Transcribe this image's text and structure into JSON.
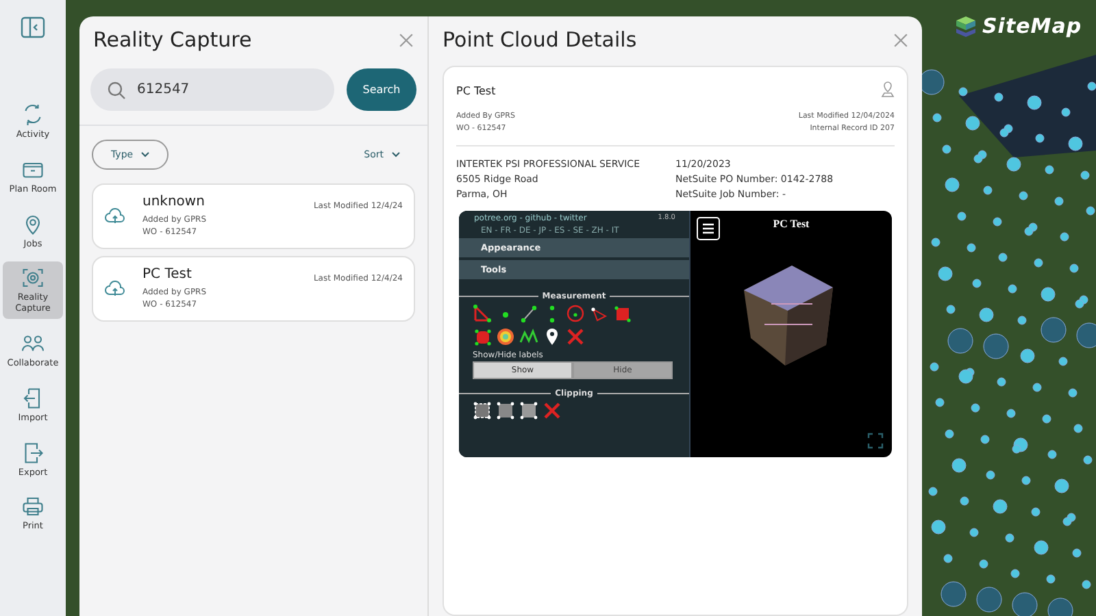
{
  "logo": {
    "text": "SiteMap"
  },
  "sidebar": {
    "items": [
      {
        "label": "Activity",
        "selected": false
      },
      {
        "label": "Plan Room",
        "selected": false
      },
      {
        "label": "Jobs",
        "selected": false
      },
      {
        "label": "Reality Capture",
        "selected": true
      },
      {
        "label": "Collaborate",
        "selected": false
      },
      {
        "label": "Import",
        "selected": false
      },
      {
        "label": "Export",
        "selected": false
      },
      {
        "label": "Print",
        "selected": false
      }
    ]
  },
  "reality_capture": {
    "title": "Reality Capture",
    "search": {
      "value": "612547",
      "button": "Search"
    },
    "filters": {
      "type": "Type",
      "sort": "Sort"
    },
    "results": [
      {
        "name": "unknown",
        "added_by": "Added by GPRS",
        "wo": "WO - 612547",
        "modified": "Last Modified 12/4/24"
      },
      {
        "name": "PC Test",
        "added_by": "Added by GPRS",
        "wo": "WO - 612547",
        "modified": "Last Modified 12/4/24"
      }
    ]
  },
  "details": {
    "title": "Point Cloud Details",
    "name": "PC Test",
    "added_by": "Added By GPRS",
    "wo": "WO - 612547",
    "modified": "Last Modified 12/04/2024",
    "record": "Internal Record ID 207",
    "address": [
      "INTERTEK PSI PROFESSIONAL SERVICE",
      "6505 Ridge Road",
      "Parma, OH"
    ],
    "info": [
      "11/20/2023",
      "NetSuite PO Number: 0142-2788",
      "NetSuite Job Number: -"
    ],
    "viewer": {
      "links": "potree.org - github - twitter",
      "version": "1.8.0",
      "languages": "EN - FR - DE - JP - ES - SE - ZH - IT",
      "menu": [
        "Appearance",
        "Tools"
      ],
      "measurement": "Measurement",
      "labels_caption": "Show/Hide labels",
      "toggle": [
        {
          "label": "Show",
          "selected": true
        },
        {
          "label": "Hide",
          "selected": false
        }
      ],
      "clipping": "Clipping",
      "scene_title": "PC Test"
    }
  }
}
